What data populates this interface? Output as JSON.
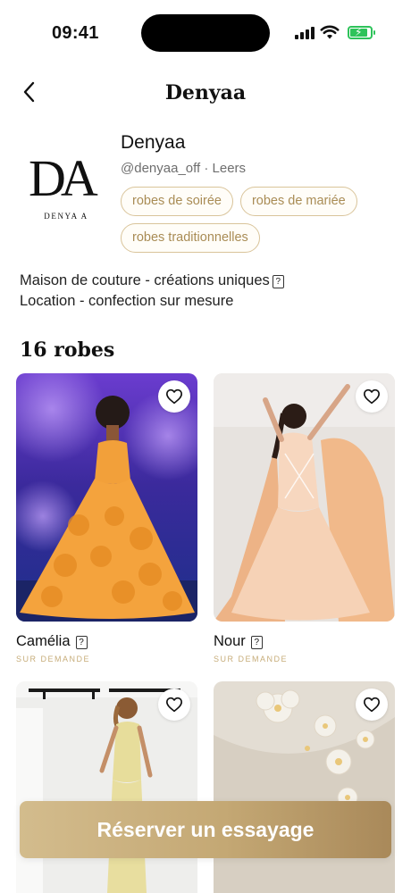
{
  "status_bar": {
    "time": "09:41"
  },
  "header": {
    "title": "Denyaa"
  },
  "profile": {
    "logo_text": "DA",
    "logo_subtitle": "DENYA A",
    "name": "Denyaa",
    "handle": "@denyaa_off · Leers",
    "tags": [
      "robes de soirée",
      "robes de mariée",
      "robes traditionnelles"
    ],
    "bio_line1": "Maison de couture - créations uniques",
    "bio_line2": "Location - confection sur mesure",
    "bio_emoji": "?"
  },
  "gallery": {
    "count_label": "16 robes",
    "items": [
      {
        "name": "Camélia",
        "emoji": "?",
        "status": "SUR DEMANDE"
      },
      {
        "name": "Nour",
        "emoji": "?",
        "status": "SUR DEMANDE"
      },
      {
        "name": "",
        "emoji": "",
        "status": ""
      },
      {
        "name": "",
        "emoji": "",
        "status": ""
      }
    ]
  },
  "cta": {
    "label": "Réserver un essayage"
  },
  "colors": {
    "accent": "#c4a874",
    "tag_border": "#d9c49a",
    "tag_text": "#a98c55",
    "battery": "#2ec35a"
  }
}
